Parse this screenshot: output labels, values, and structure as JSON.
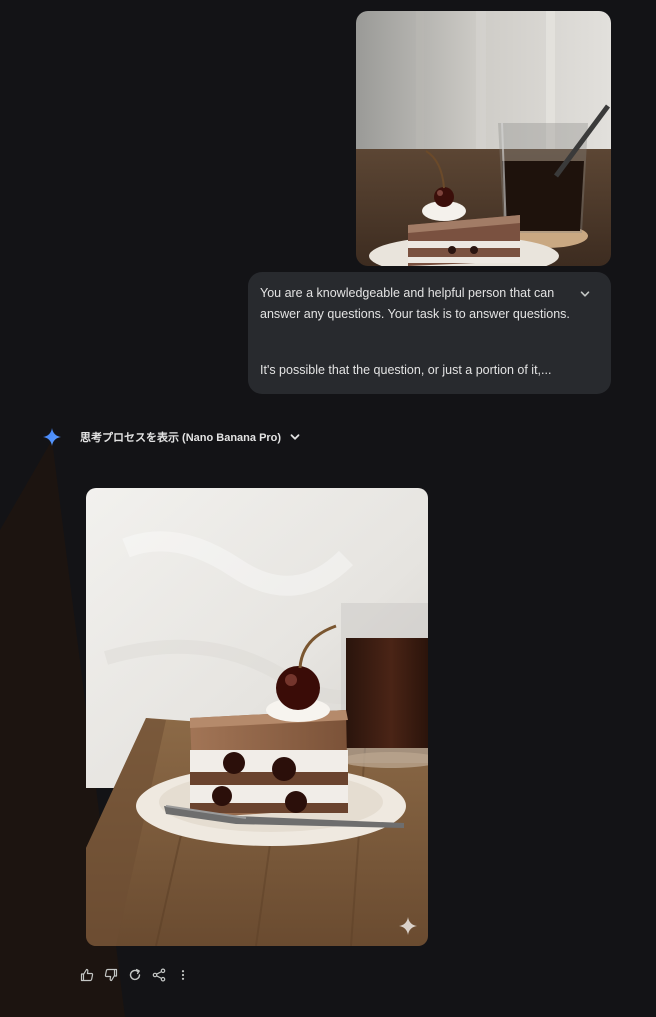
{
  "chat": {
    "user_message": {
      "image_alt": "",
      "prompt_lines": [
        "You are a knowledgeable and helpful person that can",
        "answer any questions. Your task is to answer questions.",
        "It's possible that the question, or just a portion of it,..."
      ],
      "expand_icon": "chevron-down-icon"
    },
    "model_response": {
      "model_icon": "gemini-spark-icon",
      "thinking_label": "思考プロセスを表示 (Nano Banana Pro)",
      "thinking_toggle_icon": "chevron-down-icon",
      "image_alt": "",
      "watermark_icon": "gemini-spark-icon"
    },
    "actions": [
      {
        "name": "thumbs-up-icon"
      },
      {
        "name": "thumbs-down-icon"
      },
      {
        "name": "regenerate-icon"
      },
      {
        "name": "share-icon"
      },
      {
        "name": "more-vert-icon"
      }
    ]
  },
  "colors": {
    "background": "#131316",
    "bubble": "#282a2e",
    "text": "#e3e3e3",
    "spark_blue": "#4c8df6"
  }
}
